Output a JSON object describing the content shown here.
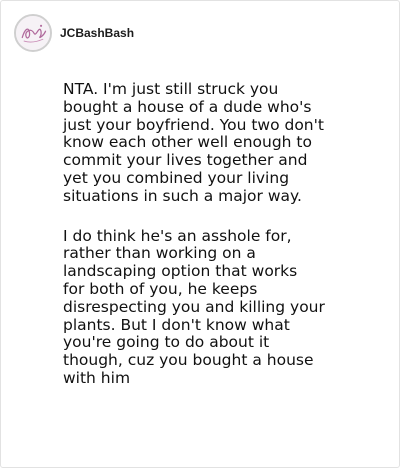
{
  "comment": {
    "username": "JCBashBash",
    "avatar_icon": "script-signature-avatar",
    "paragraphs": [
      {
        "lines": [
          "NTA. I'm just still struck you",
          "bought a house of a dude who's",
          "just your boyfriend. You two don't",
          "know each other well enough to",
          "commit your lives together and",
          "yet you combined your living",
          "situations in such a major way."
        ]
      },
      {
        "lines": [
          "I do think he's an asshole for,",
          "rather than working on a",
          "landscaping option that works",
          "for both of you, he keeps",
          "disrespecting you and killing your",
          "plants. But I don't know what",
          "you're going to do about it",
          "though, cuz you bought a house",
          "with him"
        ]
      }
    ]
  }
}
